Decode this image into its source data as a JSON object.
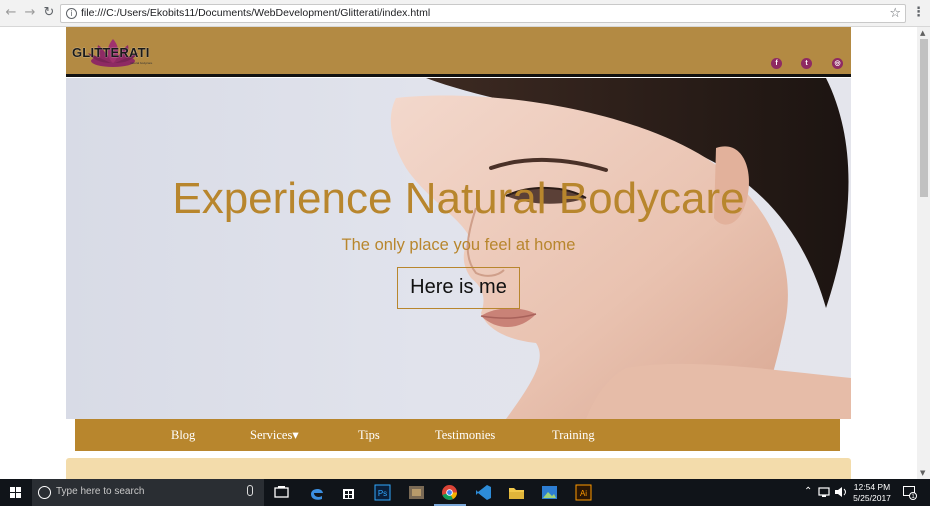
{
  "browser": {
    "url": "file:///C:/Users/Ekobits11/Documents/WebDevelopment/Glitterati/index.html",
    "back_icon": "arrow-left-icon",
    "forward_icon": "arrow-right-icon",
    "reload_icon": "reload-icon",
    "info_icon": "info-icon",
    "star_icon": "star-icon",
    "menu_icon": "kebab-menu-icon"
  },
  "site": {
    "logo_text": "GLITTERATI",
    "logo_tagline": "natural bodycare",
    "social": [
      {
        "name": "facebook-icon",
        "glyph": "f"
      },
      {
        "name": "twitter-icon",
        "glyph": "t"
      },
      {
        "name": "instagram-icon",
        "glyph": "◎"
      }
    ],
    "colors": {
      "gold": "#b8862d",
      "header": "#b38a43",
      "social": "#8e2a63",
      "band": "#f3dcab"
    }
  },
  "hero": {
    "title": "Experience Natural Bodycare",
    "subtitle": "The only place you feel at home",
    "button_label": "Here is me"
  },
  "nav": {
    "items": [
      {
        "label": "Blog"
      },
      {
        "label": "Services▾"
      },
      {
        "label": "Tips"
      },
      {
        "label": "Testimonies"
      },
      {
        "label": "Training"
      }
    ]
  },
  "taskbar": {
    "search_placeholder": "Type here to search",
    "apps": [
      "task-view-icon",
      "edge-icon",
      "store-icon",
      "photoshop-icon",
      "app-icon",
      "chrome-icon",
      "vscode-icon",
      "file-explorer-icon",
      "photos-icon",
      "illustrator-icon"
    ],
    "ps_label": "Ps",
    "ai_label": "Ai",
    "time": "12:54 PM",
    "date": "5/25/2017",
    "notification_count": "1"
  }
}
